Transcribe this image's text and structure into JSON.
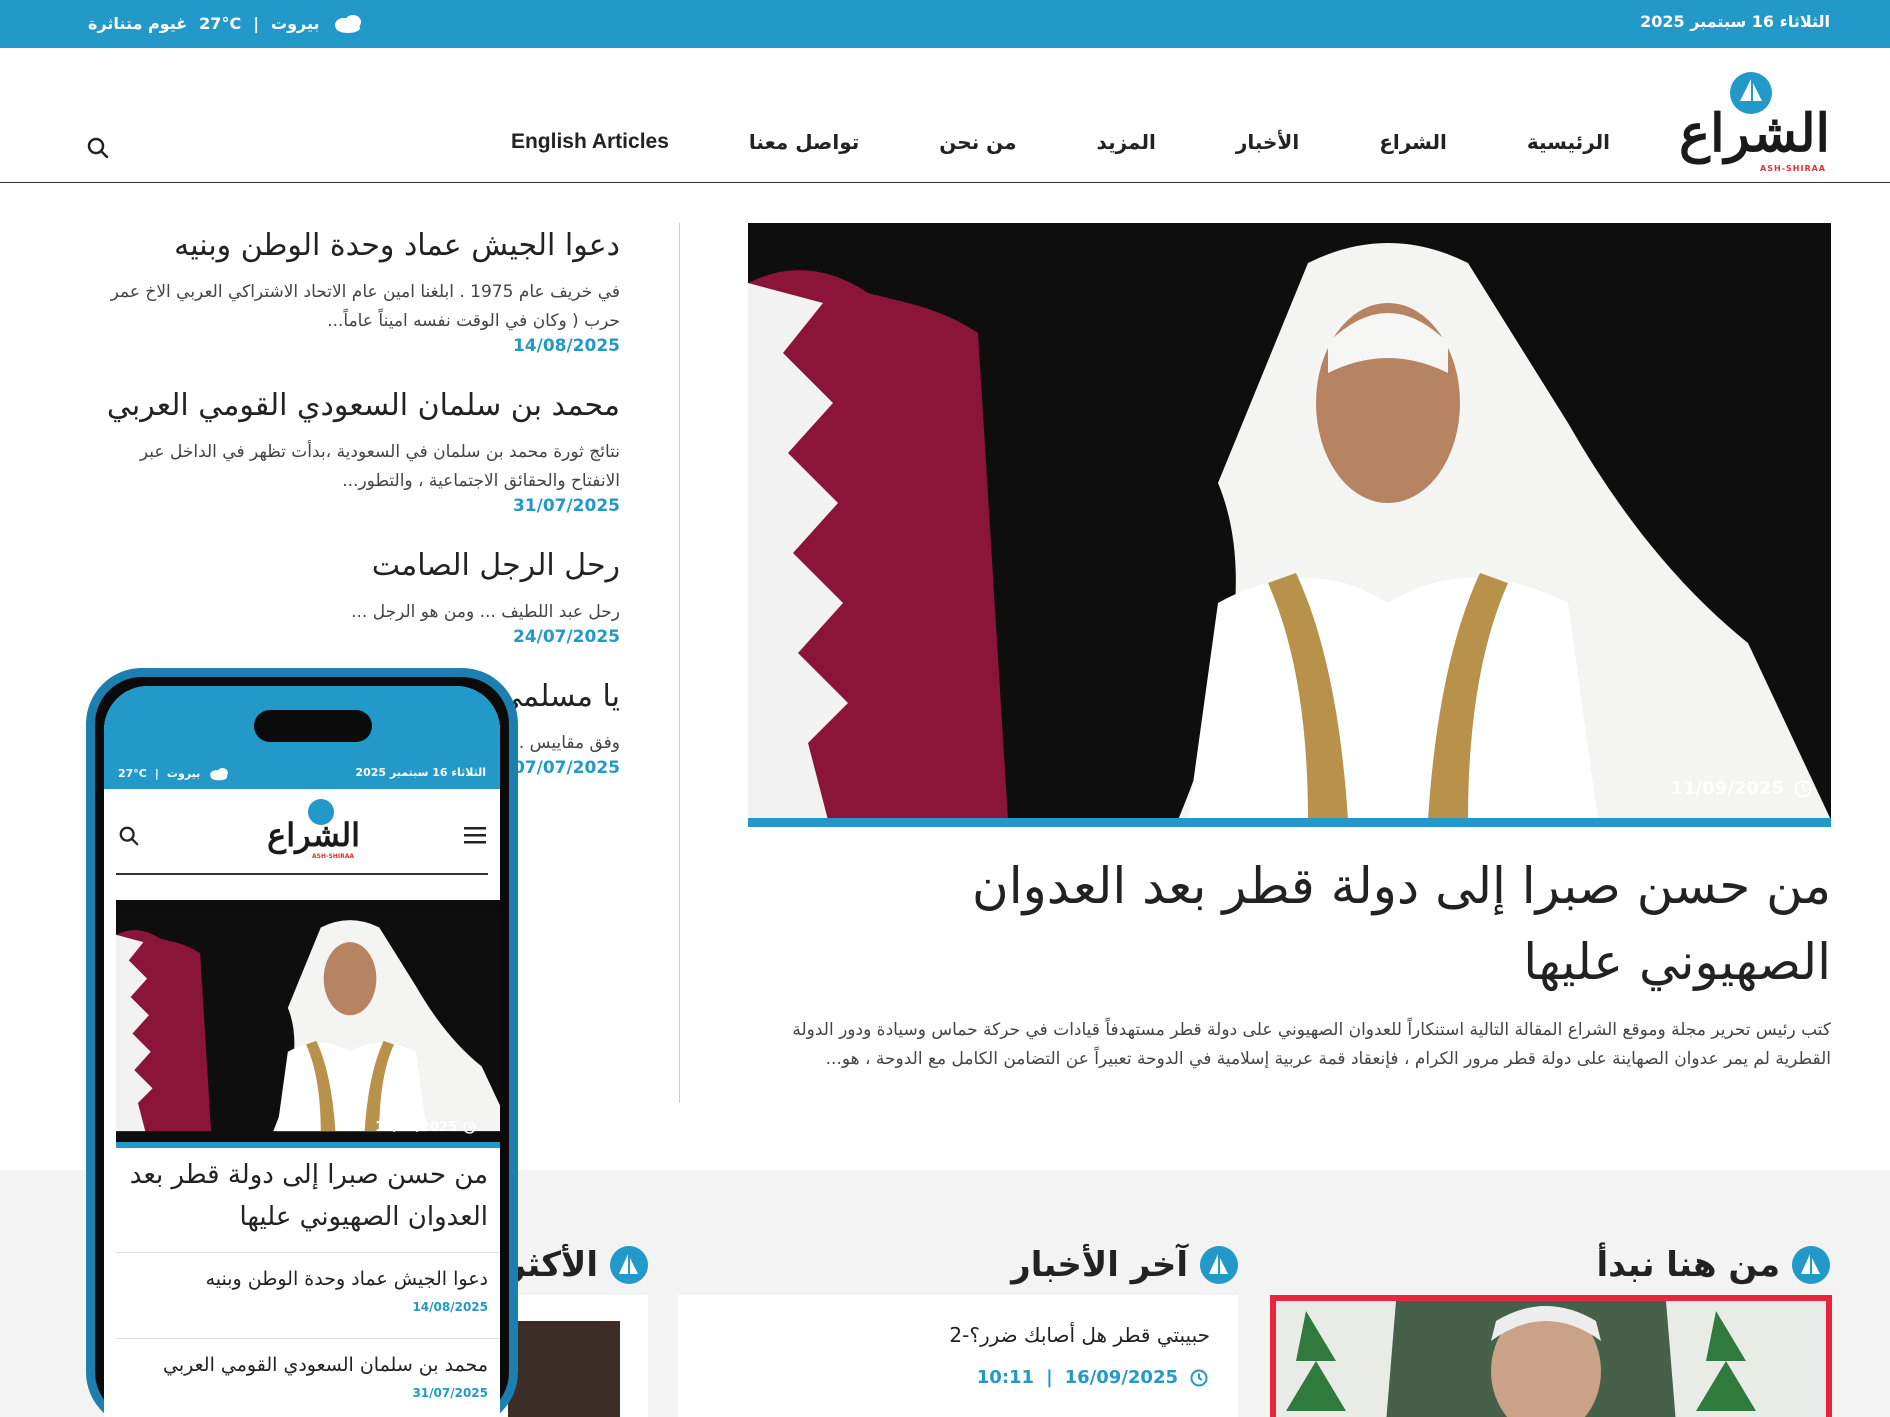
{
  "topbar": {
    "date": "الثلاثاء 16 سبتمبر 2025",
    "city": "بيروت",
    "temperature": "27°C",
    "condition": "غيوم متناثرة"
  },
  "brand": {
    "name": "الشراع",
    "subtitle": "ASH-SHIRAA"
  },
  "nav": {
    "items": [
      "الرئيسية",
      "الشراع",
      "الأخبار",
      "المزيد",
      "من نحن",
      "تواصل معنا",
      "English Articles"
    ]
  },
  "hero": {
    "date": "11/09/2025",
    "title": "من حسن صبرا إلى دولة قطر بعد العدوان الصهيوني عليها",
    "excerpt": "كتب رئيس تحرير مجلة وموقع الشراع المقالة التالية استنكاراً للعدوان الصهيوني على دولة قطر مستهدفاً قيادات في حركة حماس وسيادة ودور الدولة القطرية لم يمر عدوان الصهاينة على دولة قطر مرور الكرام ، فإنعقاد قمة عربية إسلامية في الدوحة تعبيراً عن التضامن الكامل مع الدوحة ، هو..."
  },
  "side_articles": [
    {
      "title": "دعوا الجيش عماد وحدة الوطن وبنيه",
      "excerpt": "في خريف عام 1975 . ابلغنا امين عام الاتحاد الاشتراكي العربي الاخ عمر حرب ( وكان في الوقت نفسه اميناً عاماً...",
      "date": "14/08/2025"
    },
    {
      "title": "محمد بن سلمان السعودي القومي العربي",
      "excerpt": "نتائج ثورة محمد بن سلمان في السعودية ،بدأت تظهر في الداخل عبر الانفتاح والحقائق الاجتماعية ، والتطور...",
      "date": "31/07/2025"
    },
    {
      "title": "رحل الرجل الصامت",
      "excerpt": "رحل عبد اللطيف ... ومن هو الرجل ...",
      "date": "24/07/2025"
    },
    {
      "title": "يا مسلمي ... مع الحس...",
      "excerpt": "وفق مقاييس ... الصهيوني ، و...",
      "date": "07/07/2025"
    }
  ],
  "sections": {
    "start_here": "من هنا نبدأ",
    "latest_news": "آخر الأخبار",
    "most_read": "الأكثر"
  },
  "latest_news_item": {
    "title": "حبيبتي قطر هل أصابك ضرر؟-2",
    "date": "16/09/2025",
    "time": "10:11"
  },
  "phone": {
    "date": "الثلاثاء 16 سبتمبر 2025",
    "city": "بيروت",
    "temperature": "27°C",
    "hero_date": "11/09/2025",
    "hero_title": "من حسن صبرا إلى دولة قطر بعد العدوان الصهيوني عليها",
    "items": [
      {
        "title": "دعوا الجيش عماد وحدة الوطن وبنيه",
        "date": "14/08/2025"
      },
      {
        "title": "محمد بن سلمان السعودي القومي العربي",
        "date": "31/07/2025"
      }
    ]
  },
  "colors": {
    "accent": "#2299c8",
    "highlight": "#e8253a",
    "text": "#222222"
  }
}
